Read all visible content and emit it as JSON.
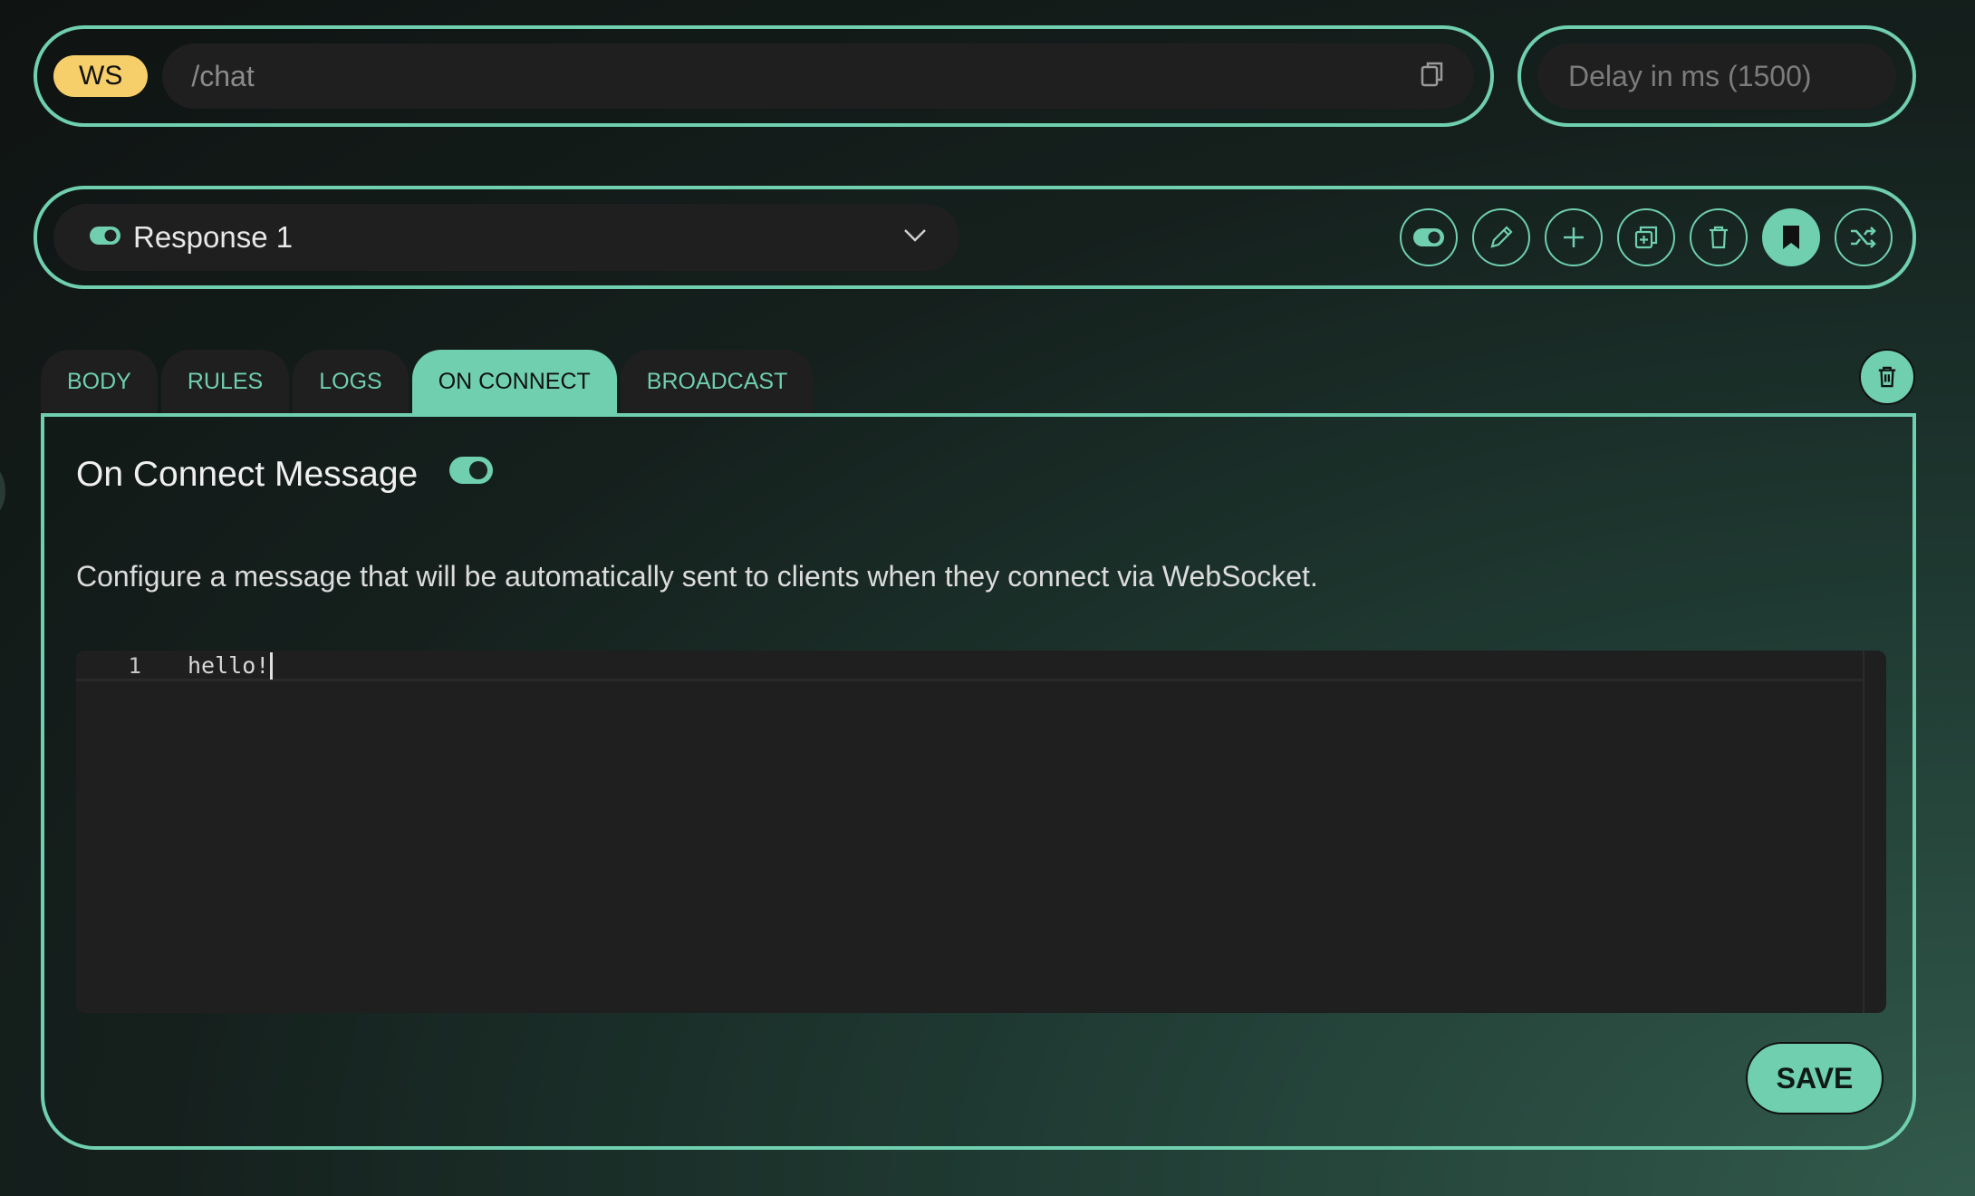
{
  "route": {
    "method_badge": "WS",
    "path": "/chat",
    "delay_placeholder": "Delay in ms (1500)"
  },
  "response": {
    "selected": "Response 1",
    "enabled": true
  },
  "toolbar_icons": [
    "toggle-icon",
    "pencil-icon",
    "plus-icon",
    "duplicate-icon",
    "trash-icon",
    "bookmark-icon",
    "shuffle-icon"
  ],
  "tabs": [
    {
      "label": "BODY",
      "active": false
    },
    {
      "label": "RULES",
      "active": false
    },
    {
      "label": "LOGS",
      "active": false
    },
    {
      "label": "ON CONNECT",
      "active": true
    },
    {
      "label": "BROADCAST",
      "active": false
    }
  ],
  "on_connect": {
    "title": "On Connect Message",
    "enabled": true,
    "description": "Configure a message that will be automatically sent to clients when they connect via WebSocket.",
    "editor_lines": [
      {
        "number": "1",
        "text": "hello!"
      }
    ],
    "save_label": "SAVE"
  },
  "colors": {
    "accent": "#6fcfae",
    "badge": "#f7cf6a",
    "field_bg": "#1f1f1f"
  }
}
